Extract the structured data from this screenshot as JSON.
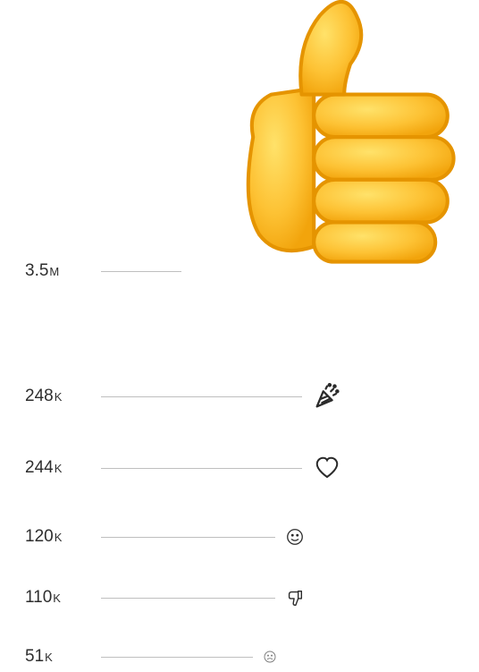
{
  "reactions": {
    "like": {
      "count_value": "3.5",
      "count_unit": "M"
    },
    "celebrate": {
      "count_value": "248",
      "count_unit": "K"
    },
    "love": {
      "count_value": "244",
      "count_unit": "K"
    },
    "smile": {
      "count_value": "120",
      "count_unit": "K"
    },
    "dislike": {
      "count_value": "110",
      "count_unit": "K"
    },
    "sad": {
      "count_value": "51",
      "count_unit": "K"
    }
  }
}
